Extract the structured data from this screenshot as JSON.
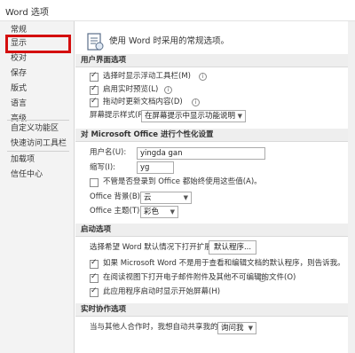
{
  "window": {
    "title": "Word 选项"
  },
  "sidebar": {
    "items": [
      {
        "label": "常规"
      },
      {
        "label": "显示"
      },
      {
        "label": "校对"
      },
      {
        "label": "保存"
      },
      {
        "label": "版式"
      },
      {
        "label": "语言"
      },
      {
        "label": "高级"
      },
      {
        "label": "自定义功能区"
      },
      {
        "label": "快速访问工具栏"
      },
      {
        "label": "加载项"
      },
      {
        "label": "信任中心"
      }
    ]
  },
  "main": {
    "intro": "使用 Word 时采用的常规选项。",
    "ui_section": {
      "header": "用户界面选项",
      "options": [
        {
          "label": "选择时显示浮动工具栏(M)",
          "checked": true
        },
        {
          "label": "启用实时预览(L)",
          "checked": true
        },
        {
          "label": "拖动时更新文档内容(D)",
          "checked": true
        }
      ],
      "screentip_label": "屏幕提示样式(R):",
      "screentip_value": "在屏幕提示中显示功能说明"
    },
    "personalize_section": {
      "header": "对 Microsoft Office 进行个性化设置",
      "username_label": "用户名(U):",
      "username_value": "yingda gan",
      "initials_label": "缩写(I):",
      "initials_value": "yg",
      "always_use_label": "不管是否登录到 Office 都始终使用这些值(A)。",
      "always_use_checked": false,
      "background_label": "Office 背景(B):",
      "background_value": "云",
      "theme_label": "Office 主题(T):",
      "theme_value": "彩色"
    },
    "startup_section": {
      "header": "启动选项",
      "default_programs_label": "选择希望 Word 默认情况下打开扩展名:",
      "default_programs_button": "默认程序...",
      "options": [
        {
          "label": "如果 Microsoft Word 不是用于查看和编辑文档的默认程序，则告诉我。",
          "checked": true
        },
        {
          "label": "在阅读视图下打开电子邮件附件及其他不可编辑的文件(O)",
          "checked": true
        },
        {
          "label": "此应用程序启动时显示开始屏幕(H)",
          "checked": true
        }
      ]
    },
    "coauthor_section": {
      "header": "实时协作选项",
      "share_label": "当与其他人合作时，我想自动共享我的更改:",
      "share_value": "询问我"
    }
  },
  "colors": {
    "highlight": "#d40e0e",
    "sidebar_bg": "#f3f3f3",
    "section_bg": "#eeeeee"
  }
}
